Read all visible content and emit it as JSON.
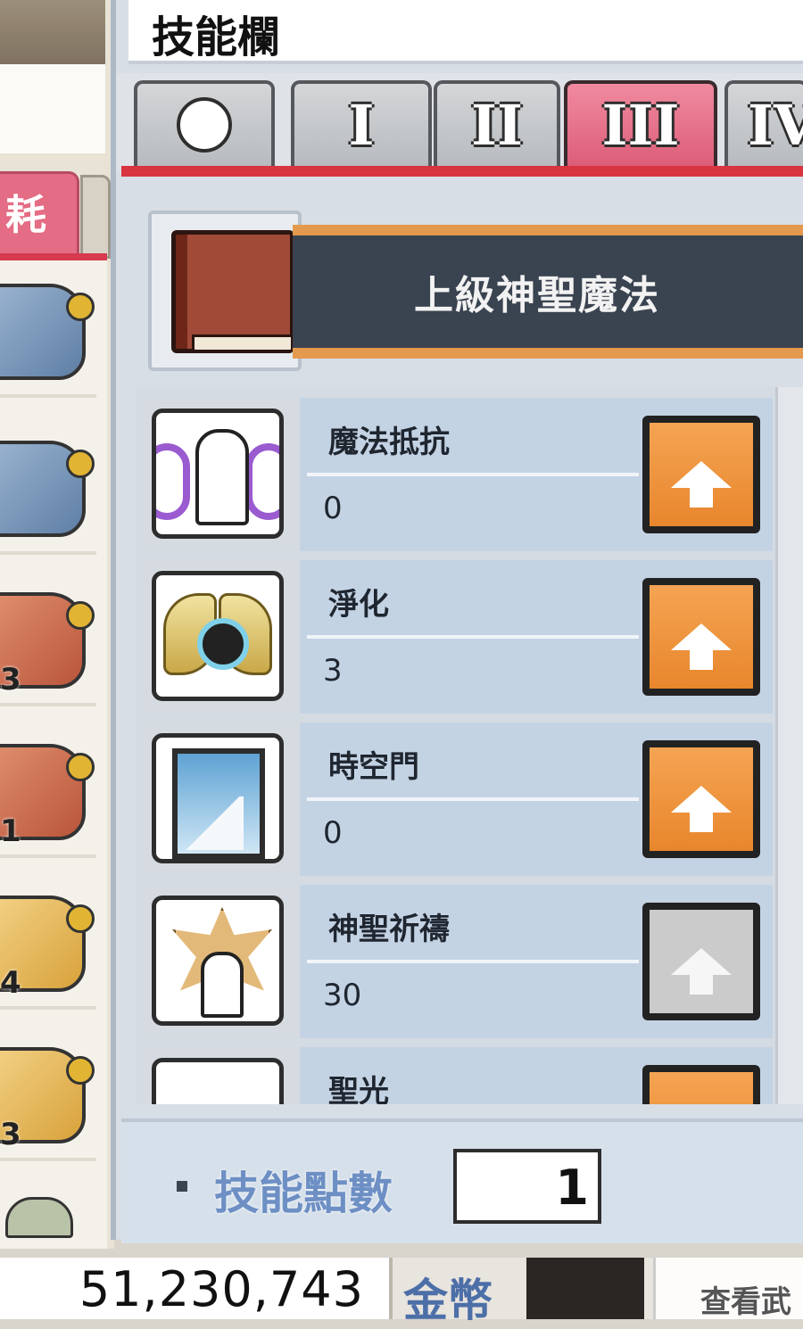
{
  "window": {
    "title": "技能欄"
  },
  "tabs": [
    {
      "label": "",
      "icon": "circle-icon",
      "active": false
    },
    {
      "label": "I",
      "active": false
    },
    {
      "label": "II",
      "active": false
    },
    {
      "label": "III",
      "active": true
    },
    {
      "label": "IV",
      "active": false
    }
  ],
  "job": {
    "name": "上級神聖魔法",
    "icon": "book-icon"
  },
  "skills": [
    {
      "name": "魔法抵抗",
      "level": "0",
      "icon": "magic-resistance-icon",
      "can_level_up": true
    },
    {
      "name": "淨化",
      "level": "3",
      "icon": "purification-icon",
      "can_level_up": true
    },
    {
      "name": "時空門",
      "level": "0",
      "icon": "mystic-door-icon",
      "can_level_up": true
    },
    {
      "name": "神聖祈禱",
      "level": "30",
      "icon": "holy-prayer-icon",
      "can_level_up": false
    },
    {
      "name": "聖光",
      "level": "",
      "icon": "holy-light-icon",
      "can_level_up": true
    }
  ],
  "skill_points": {
    "label": "技能點數",
    "value": "1"
  },
  "inventory": {
    "tab_label": "耗",
    "counts": [
      "",
      "",
      "3",
      "1",
      "4",
      "3",
      ""
    ]
  },
  "footer": {
    "meso_value": "51,230,743",
    "meso_label": "金幣",
    "view_label": "查看武"
  },
  "colors": {
    "active_tab": "#e46c84",
    "level_up_button": "#f09a42",
    "disabled_button": "#cbcbcb",
    "row_background": "#c4d3e4",
    "accent_red": "#d8343f"
  }
}
